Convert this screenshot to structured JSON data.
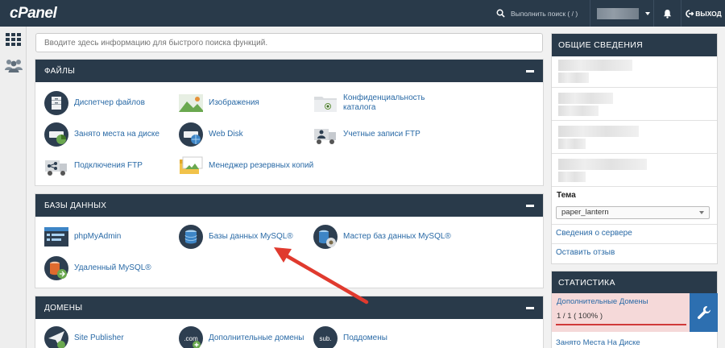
{
  "app": {
    "logo": "cPanel"
  },
  "topbar": {
    "search_placeholder": "Выполнить поиск ( / )",
    "logout_label": "ВЫХОД"
  },
  "search": {
    "placeholder": "Вводите здесь информацию для быстрого поиска функций."
  },
  "files": {
    "title": "ФАЙЛЫ",
    "items": [
      {
        "label": "Диспетчер файлов",
        "icon": "file-manager-icon"
      },
      {
        "label": "Изображения",
        "icon": "images-icon"
      },
      {
        "label": "Конфиденциальность каталога",
        "icon": "directory-privacy-icon"
      },
      {
        "label": "Занято места на диске",
        "icon": "disk-usage-icon"
      },
      {
        "label": "Web Disk",
        "icon": "web-disk-icon"
      },
      {
        "label": "Учетные записи FTP",
        "icon": "ftp-accounts-icon"
      },
      {
        "label": "Подключения FTP",
        "icon": "ftp-connections-icon"
      },
      {
        "label": "Менеджер резервных копий",
        "icon": "backup-manager-icon"
      }
    ]
  },
  "databases": {
    "title": "БАЗЫ ДАННЫХ",
    "items": [
      {
        "label": "phpMyAdmin",
        "icon": "phpmyadmin-icon"
      },
      {
        "label": "Базы данных MySQL®",
        "icon": "mysql-databases-icon"
      },
      {
        "label": "Мастер баз данных MySQL®",
        "icon": "mysql-wizard-icon"
      },
      {
        "label": "Удаленный MySQL®",
        "icon": "remote-mysql-icon"
      }
    ]
  },
  "domains": {
    "title": "ДОМЕНЫ",
    "items": [
      {
        "label": "Site Publisher",
        "icon": "site-publisher-icon"
      },
      {
        "label": "Дополнительные домены",
        "icon": "addon-domains-icon"
      },
      {
        "label": "Поддомены",
        "icon": "subdomains-icon"
      }
    ]
  },
  "general_info": {
    "title": "ОБЩИЕ СВЕДЕНИЯ",
    "theme_label": "Тема",
    "theme_value": "paper_lantern",
    "server_info_link": "Сведения о сервере",
    "feedback_link": "Оставить отзыв"
  },
  "statistics": {
    "title": "СТАТИСТИКА",
    "addon_domains_label": "Дополнительные Домены",
    "addon_domains_value": "1 / 1 ( 100% )",
    "addon_domains_usage": 1.0,
    "disk_usage_label": "Занято Места На Диске"
  },
  "colors": {
    "header": "#293a4a",
    "link": "#2a6aa6",
    "alert_bg": "#f5d9d9",
    "alert_bar": "#d03a3a",
    "annotation_arrow": "#e03a2e"
  }
}
